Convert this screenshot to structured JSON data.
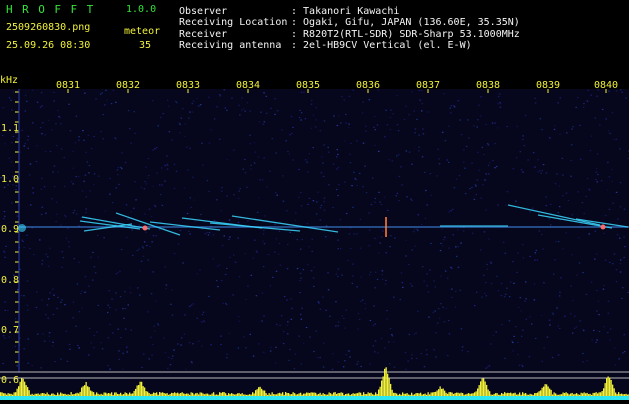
{
  "header": {
    "logo": "HROFFT",
    "version": "1.0.0",
    "filename": "2509260830.png",
    "datetime": "25.09.26 08:30",
    "meteor_label": "meteor",
    "meteor_count": "35",
    "fields": [
      {
        "label": "Observer",
        "value": ": Takanori Kawachi"
      },
      {
        "label": "Receiving Location",
        "value": ": Ogaki, Gifu, JAPAN (136.60E, 35.35N)"
      },
      {
        "label": "Receiver",
        "value": ": R820T2(RTL-SDR) SDR-Sharp 53.1000MHz"
      },
      {
        "label": "Receiving antenna",
        "value": ": 2el-HB9CV Vertical (el. E-W)"
      }
    ]
  },
  "plot": {
    "unit": "kHz",
    "time_ticks": [
      "0831",
      "0832",
      "0833",
      "0834",
      "0835",
      "0836",
      "0837",
      "0838",
      "0839",
      "0840"
    ],
    "freq_ticks": [
      "1.1",
      "1.0",
      "0.9",
      "0.8",
      "0.7",
      "0.6"
    ],
    "colors": {
      "background": "#06061c",
      "label": "#f2f23a",
      "trace": "#3ad6ff",
      "bars": "#f2f23a",
      "baseline": "#2ae6f0"
    }
  }
}
